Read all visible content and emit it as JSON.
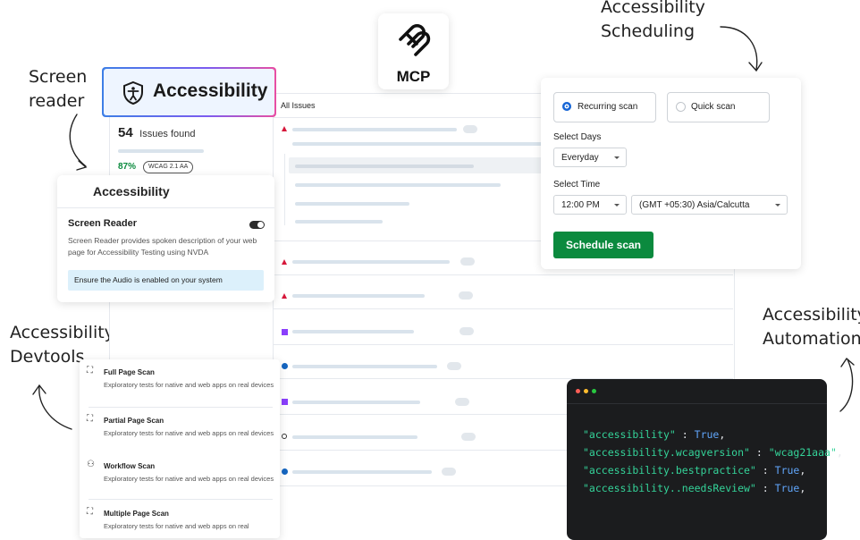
{
  "annotations": {
    "screen_reader": [
      "Screen",
      "reader"
    ],
    "scheduling": [
      "Accessibility",
      "Scheduling"
    ],
    "devtools": [
      "Accessibility",
      "Devtools"
    ],
    "automation": [
      "Accessibility",
      "Automation"
    ]
  },
  "mcp": {
    "label": "MCP"
  },
  "accessibility_header": {
    "title": "Accessibility"
  },
  "summary": {
    "issues_count": "54",
    "issues_label": "Issues found",
    "score": "87%",
    "standard_badge": "WCAG 2.1 AA"
  },
  "issues_list": {
    "header": "All Issues"
  },
  "screen_reader_panel": {
    "title": "Accessibility",
    "section_title": "Screen Reader",
    "description": "Screen Reader provides spoken description of your web page for Accessibility Testing using NVDA",
    "notice": "Ensure the Audio is enabled on your system",
    "toggle_on": true
  },
  "scheduling_panel": {
    "recurring_label": "Recurring scan",
    "quick_label": "Quick scan",
    "selected": "recurring",
    "days_label": "Select Days",
    "days_value": "Everyday",
    "time_label": "Select Time",
    "time_value": "12:00 PM",
    "timezone_value": "(GMT +05:30) Asia/Calcutta",
    "schedule_button": "Schedule scan",
    "accent": "#0b8a3e"
  },
  "scan_types": [
    {
      "title": "Full Page Scan",
      "desc": "Exploratory tests for native and web apps on real devices"
    },
    {
      "title": "Partial Page Scan",
      "desc": "Exploratory tests for native and web apps on real devices"
    },
    {
      "title": "Workflow Scan",
      "desc": "Exploratory tests for native and web apps on real devices"
    },
    {
      "title": "Multiple Page Scan",
      "desc": "Exploratory tests for native and web apps on real"
    }
  ],
  "code_snippet": {
    "lines": [
      {
        "key": "\"accessibility\"",
        "sep": " : ",
        "val": "True",
        "end": ","
      },
      {
        "key": "\"accessibility.wcagversion\"",
        "sep": " : ",
        "val": "\"wcag21aaa\"",
        "end": ","
      },
      {
        "key": "\"accessibility.bestpractice\"",
        "sep": " : ",
        "val": "True",
        "end": ","
      },
      {
        "key": "\"accessibility..needsReview\"",
        "sep": " : ",
        "val": "True",
        "end": ","
      }
    ],
    "window_dots": [
      "#ff5f57",
      "#febc2e",
      "#28c840"
    ]
  }
}
